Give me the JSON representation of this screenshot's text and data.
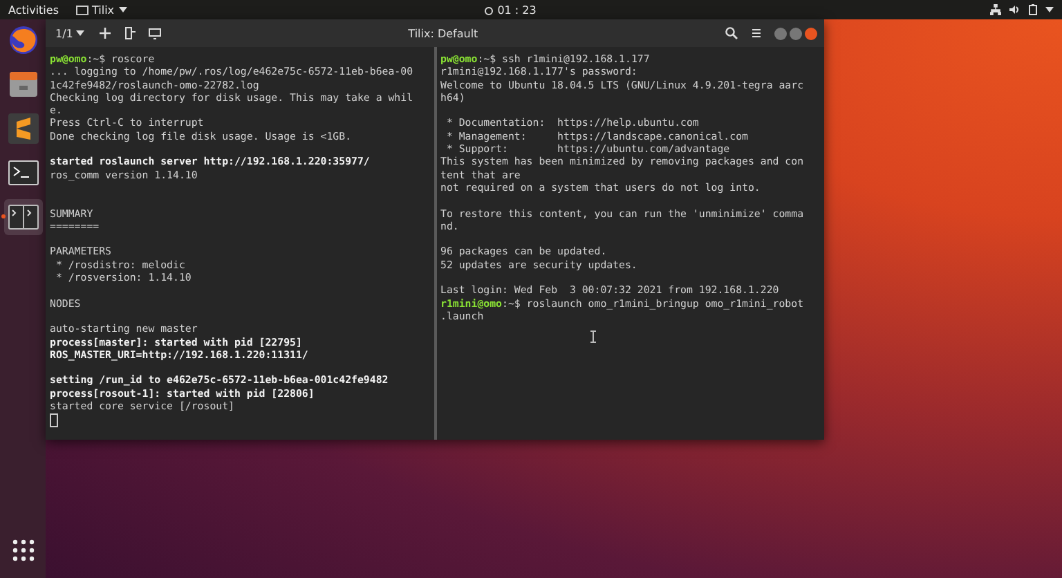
{
  "top_bar": {
    "activities": "Activities",
    "app_menu": "Tilix",
    "clock": "01 : 23"
  },
  "dock": {
    "items": [
      {
        "kind": "browser",
        "selected": false
      },
      {
        "kind": "files",
        "selected": false
      },
      {
        "kind": "editor",
        "selected": false
      },
      {
        "kind": "terminal",
        "selected": false
      },
      {
        "kind": "tilix",
        "selected": true
      }
    ]
  },
  "window": {
    "session": "1/1",
    "title": "Tilix: Default"
  },
  "panes": [
    {
      "lines": [
        {
          "kind": "prompt",
          "user": "pw@omo",
          "text": ":~$ roscore"
        },
        {
          "kind": "text",
          "text": "... logging to /home/pw/.ros/log/e462e75c-6572-11eb-b6ea-00"
        },
        {
          "kind": "text",
          "text": "1c42fe9482/roslaunch-omo-22782.log"
        },
        {
          "kind": "text",
          "text": "Checking log directory for disk usage. This may take a whil"
        },
        {
          "kind": "text",
          "text": "e."
        },
        {
          "kind": "text",
          "text": "Press Ctrl-C to interrupt"
        },
        {
          "kind": "text",
          "text": "Done checking log file disk usage. Usage is <1GB."
        },
        {
          "kind": "blank"
        },
        {
          "kind": "bold",
          "text": "started roslaunch server http://192.168.1.220:35977/"
        },
        {
          "kind": "text",
          "text": "ros_comm version 1.14.10"
        },
        {
          "kind": "blank"
        },
        {
          "kind": "blank"
        },
        {
          "kind": "text",
          "text": "SUMMARY"
        },
        {
          "kind": "text",
          "text": "========"
        },
        {
          "kind": "blank"
        },
        {
          "kind": "text",
          "text": "PARAMETERS"
        },
        {
          "kind": "text",
          "text": " * /rosdistro: melodic"
        },
        {
          "kind": "text",
          "text": " * /rosversion: 1.14.10"
        },
        {
          "kind": "blank"
        },
        {
          "kind": "text",
          "text": "NODES"
        },
        {
          "kind": "blank"
        },
        {
          "kind": "text",
          "text": "auto-starting new master"
        },
        {
          "kind": "bold",
          "text": "process[master]: started with pid [22795]"
        },
        {
          "kind": "bold",
          "text": "ROS_MASTER_URI=http://192.168.1.220:11311/"
        },
        {
          "kind": "blank"
        },
        {
          "kind": "bold",
          "text": "setting /run_id to e462e75c-6572-11eb-b6ea-001c42fe9482"
        },
        {
          "kind": "bold",
          "text": "process[rosout-1]: started with pid [22806]"
        },
        {
          "kind": "text",
          "text": "started core service [/rosout]"
        },
        {
          "kind": "cursor"
        }
      ]
    },
    {
      "lines": [
        {
          "kind": "prompt",
          "user": "pw@omo",
          "text": ":~$ ssh r1mini@192.168.1.177"
        },
        {
          "kind": "text",
          "text": "r1mini@192.168.1.177's password:"
        },
        {
          "kind": "text",
          "text": "Welcome to Ubuntu 18.04.5 LTS (GNU/Linux 4.9.201-tegra aarc"
        },
        {
          "kind": "text",
          "text": "h64)"
        },
        {
          "kind": "blank"
        },
        {
          "kind": "text",
          "text": " * Documentation:  https://help.ubuntu.com"
        },
        {
          "kind": "text",
          "text": " * Management:     https://landscape.canonical.com"
        },
        {
          "kind": "text",
          "text": " * Support:        https://ubuntu.com/advantage"
        },
        {
          "kind": "text",
          "text": "This system has been minimized by removing packages and con"
        },
        {
          "kind": "text",
          "text": "tent that are"
        },
        {
          "kind": "text",
          "text": "not required on a system that users do not log into."
        },
        {
          "kind": "blank"
        },
        {
          "kind": "text",
          "text": "To restore this content, you can run the 'unminimize' comma"
        },
        {
          "kind": "text",
          "text": "nd."
        },
        {
          "kind": "blank"
        },
        {
          "kind": "text",
          "text": "96 packages can be updated."
        },
        {
          "kind": "text",
          "text": "52 updates are security updates."
        },
        {
          "kind": "blank"
        },
        {
          "kind": "text",
          "text": "Last login: Wed Feb  3 00:07:32 2021 from 192.168.1.220"
        },
        {
          "kind": "prompt",
          "user": "r1mini@omo",
          "text": ":~$ roslaunch omo_r1mini_bringup omo_r1mini_robot"
        },
        {
          "kind": "text",
          "text": ".launch"
        }
      ]
    }
  ]
}
